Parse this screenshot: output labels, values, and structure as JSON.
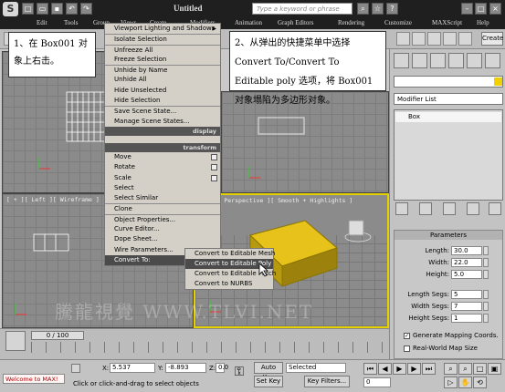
{
  "window": {
    "title": "Untitled",
    "search_placeholder": "Type a keyword or phrase"
  },
  "menu": {
    "items": [
      "Edit",
      "Tools",
      "Group",
      "Views",
      "Create",
      "Modifiers",
      "Animation",
      "Graph Editors",
      "Rendering",
      "Customize",
      "MAXScript",
      "Help"
    ]
  },
  "toolbar": {
    "create_label": "Create"
  },
  "viewports": {
    "left_label": "[ + ][ Left ][ Wireframe ]",
    "persp_label": "[ + ][ Perspective ][ Smooth + Highlights ]"
  },
  "quad_menu": {
    "items_top": [
      "Viewport Lighting and Shadows",
      "Isolate Selection",
      "Unfreeze All",
      "Freeze Selection",
      "Unhide by Name",
      "Unhide All",
      "Hide Unselected",
      "Hide Selection",
      "Save Scene State...",
      "Manage Scene States..."
    ],
    "display_header": "display",
    "transform_header": "transform",
    "items_bottom": [
      "Move",
      "Rotate",
      "Scale",
      "Select",
      "Select Similar",
      "Clone",
      "Object Properties...",
      "Curve Editor...",
      "Dope Sheet...",
      "Wire Parameters...",
      "Convert To:"
    ],
    "submenu": [
      "Convert to Editable Mesh",
      "Convert to Editable Poly",
      "Convert to Editable Patch",
      "Convert to NURBS"
    ]
  },
  "callouts": {
    "step1": "1、在 Box001 对象上右击。",
    "step2": "2、从弹出的快捷菜单中选择 Convert To/Convert To Editable poly 选项，将 Box001 对象塌陷为多边形对象。"
  },
  "command_panel": {
    "modifier_list": "Modifier List",
    "stack_item": "Box",
    "params_header": "Parameters",
    "params": [
      {
        "label": "Length:",
        "value": "30.0"
      },
      {
        "label": "Width:",
        "value": "22.0"
      },
      {
        "label": "Height:",
        "value": "5.0"
      },
      {
        "label": "Length Segs:",
        "value": "5"
      },
      {
        "label": "Width Segs:",
        "value": "7"
      },
      {
        "label": "Height Segs:",
        "value": "1"
      }
    ],
    "gen_mapping": "Generate Mapping Coords.",
    "real_world": "Real-World Map Size"
  },
  "timeline": {
    "frame": "0 / 100"
  },
  "status": {
    "maxscript": "Welcome to MAX!",
    "prompt": "Click or click-and-drag to select objects",
    "x": "5.537",
    "y": "-8.893",
    "z": "0.0",
    "auto_key": "Auto Key",
    "selected": "Selected",
    "set_key": "Set Key",
    "key_filters": "Key Filters...",
    "frame_field": "0"
  },
  "watermark": "騰龍視覺 WWW.TLVI.NET"
}
